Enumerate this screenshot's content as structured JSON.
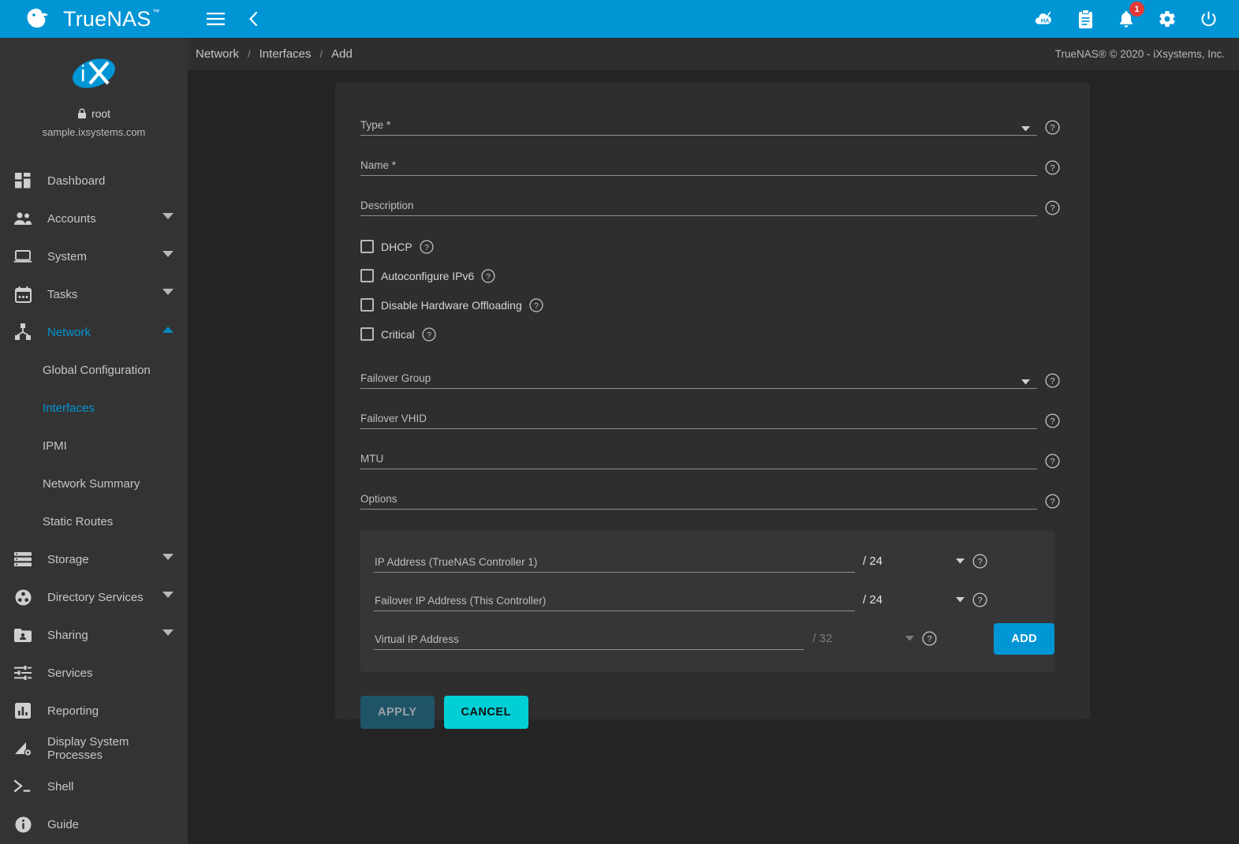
{
  "topbar": {
    "brand": "TrueNAS",
    "brand_tm": "™",
    "menu_icon": "hamburger-menu-icon",
    "back_icon": "chevron-left-icon",
    "ha_icon": "ha-cloud-icon",
    "clipboard_icon": "clipboard-icon",
    "bell_icon": "notifications-bell-icon",
    "notification_count": "1",
    "settings_icon": "gear-icon",
    "power_icon": "power-icon",
    "accent_color": "#0095d5"
  },
  "breadcrumb": {
    "items": [
      "Network",
      "Interfaces",
      "Add"
    ],
    "separator": "/",
    "copyright": "TrueNAS® © 2020 - iXsystems, Inc."
  },
  "sidebar": {
    "logo": "ix-systems-logo",
    "lock_icon": "lock-icon",
    "username": "root",
    "hostname": "sample.ixsystems.com",
    "items": [
      {
        "label": "Dashboard",
        "icon": "dashboard-icon",
        "expandable": false,
        "active": false
      },
      {
        "label": "Accounts",
        "icon": "accounts-people-icon",
        "expandable": true,
        "active": false
      },
      {
        "label": "System",
        "icon": "system-laptop-icon",
        "expandable": true,
        "active": false
      },
      {
        "label": "Tasks",
        "icon": "tasks-calendar-icon",
        "expandable": true,
        "active": false
      },
      {
        "label": "Network",
        "icon": "network-node-icon",
        "expandable": true,
        "active": true,
        "expanded": true
      },
      {
        "label": "Storage",
        "icon": "storage-stack-icon",
        "expandable": true,
        "active": false
      },
      {
        "label": "Directory Services",
        "icon": "directory-services-icon",
        "expandable": true,
        "active": false
      },
      {
        "label": "Sharing",
        "icon": "sharing-folder-icon",
        "expandable": true,
        "active": false
      },
      {
        "label": "Services",
        "icon": "services-sliders-icon",
        "expandable": false,
        "active": false
      },
      {
        "label": "Reporting",
        "icon": "reporting-chart-icon",
        "expandable": false,
        "active": false
      },
      {
        "label": "Display System Processes",
        "icon": "system-processes-icon",
        "expandable": false,
        "active": false
      },
      {
        "label": "Shell",
        "icon": "shell-terminal-icon",
        "expandable": false,
        "active": false
      },
      {
        "label": "Guide",
        "icon": "guide-info-icon",
        "expandable": false,
        "active": false
      }
    ],
    "network_subitems": [
      {
        "label": "Global Configuration",
        "active": false
      },
      {
        "label": "Interfaces",
        "active": true
      },
      {
        "label": "IPMI",
        "active": false
      },
      {
        "label": "Network Summary",
        "active": false
      },
      {
        "label": "Static Routes",
        "active": false
      }
    ]
  },
  "form": {
    "fields": [
      {
        "label": "Type *",
        "value": "",
        "type": "select",
        "help": "help-icon"
      },
      {
        "label": "Name *",
        "value": "",
        "type": "text",
        "help": "help-icon"
      },
      {
        "label": "Description",
        "value": "",
        "type": "text",
        "help": "help-icon"
      }
    ],
    "checkboxes": [
      {
        "label": "DHCP",
        "checked": false
      },
      {
        "label": "Autoconfigure IPv6",
        "checked": false
      },
      {
        "label": "Disable Hardware Offloading",
        "checked": false
      },
      {
        "label": "Critical",
        "checked": false
      }
    ],
    "fields2": [
      {
        "label": "Failover Group",
        "value": "",
        "type": "select",
        "help": "help-icon"
      },
      {
        "label": "Failover VHID",
        "value": "",
        "type": "text",
        "help": "help-icon"
      },
      {
        "label": "MTU",
        "value": "",
        "type": "text",
        "help": "help-icon"
      },
      {
        "label": "Options",
        "value": "",
        "type": "text",
        "help": "help-icon"
      }
    ],
    "ip_rows": [
      {
        "label": "IP Address (TrueNAS Controller 1)",
        "value": "",
        "netmask": "/ 24",
        "dimmed": false
      },
      {
        "label": "Failover IP Address (This Controller)",
        "value": "",
        "netmask": "/ 24",
        "dimmed": false
      },
      {
        "label": "Virtual IP Address",
        "value": "",
        "netmask": "/ 32",
        "dimmed": true
      }
    ],
    "add_label": "ADD",
    "apply_label": "APPLY",
    "cancel_label": "CANCEL",
    "add_color": "#0095d5",
    "cancel_color": "#00d0d6",
    "apply_color": "#1f5467"
  }
}
